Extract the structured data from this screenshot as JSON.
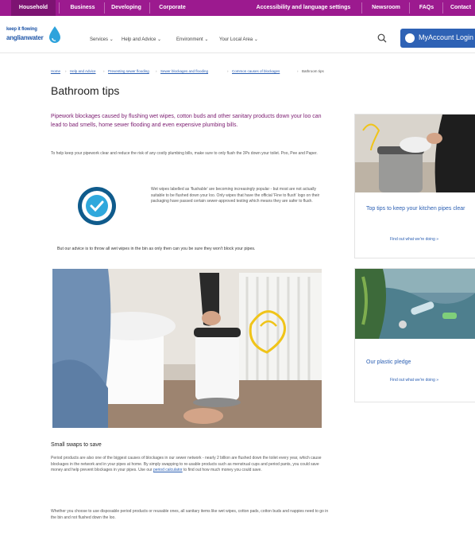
{
  "topnav": {
    "tabs": [
      "Household",
      "Business",
      "Developing",
      "Corporate"
    ],
    "right_links": [
      "Accessibility and language settings",
      "Newsroom",
      "FAQs",
      "Contact"
    ]
  },
  "header": {
    "logo_line1": "keep it flowing",
    "logo_line2": "anglianwater",
    "nav": [
      "Services",
      "Help and Advice",
      "Environment",
      "Your Local Area"
    ],
    "account_button": "MyAccount Login"
  },
  "breadcrumb": [
    "Home",
    "Help and Advice",
    "Preventing sewer flooding",
    "Sewer blockages and flooding",
    "Common causes of blockages",
    "Bathroom tips"
  ],
  "main": {
    "title": "Bathroom tips",
    "lead": "Pipework blockages caused by flushing wet wipes, cotton buds and other sanitary products down your loo can lead to bad smells, home sewer flooding and even expensive plumbing bills.",
    "intro": "To help keep your pipework clear and reduce the risk of any costly plumbing bills, make sure to only flush the 3Ps down your toilet. Poo, Pee and Paper.",
    "badge_text": "FINE TO FLUSH",
    "wipes_text": "Wet wipes labelled as 'flushable' are becoming increasingly popular - but most are not actually suitable to be flushed down your loo. Only wipes that have the official 'Fine to flush' logo on their packaging have passed certain sewer-approved testing which means they are safer to flush.",
    "advice": "But our advice is to throw all wet wipes in the bin as only then can you be sure they won't block your pipes.",
    "section_title": "Small swaps to save",
    "swaps_text_1": "Period products are also one of the biggest causes of blockages in our sewer network - nearly 2 billion are flushed down the toilet every year, which cause blockages in the network and in your pipes at home. By simply swapping to re-usable products such as menstrual cups and period pants, you could save money and help prevent blockages in your pipes. Use our",
    "swaps_link": "period calculator",
    "swaps_text_2": "to find out how much money you could save.",
    "closing": "Whether you choose to use disposable period products or reusable ones, all sanitary items like wet wipes, cotton pads, cotton buds and nappies need to go in the bin and not flushed down the loo."
  },
  "sidebar": {
    "cards": [
      {
        "title": "Top tips to keep your kitchen pipes clear",
        "link": "Find out what we're doing »"
      },
      {
        "title": "Our plastic pledge",
        "link": "Find out what we're doing »"
      }
    ]
  },
  "colors": {
    "brand_purple": "#9c1a8f",
    "brand_blue": "#2e62b5",
    "lead_text": "#7a1a6f"
  }
}
